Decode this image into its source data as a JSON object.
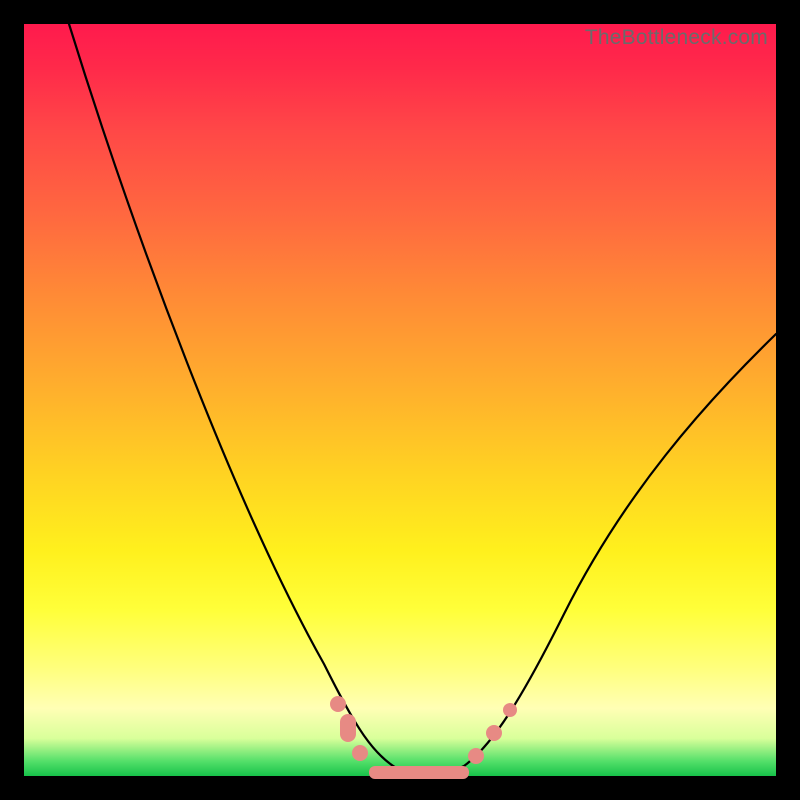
{
  "watermark": "TheBottleneck.com",
  "colors": {
    "background_frame": "#000000",
    "gradient_top": "#ff1a4d",
    "gradient_mid": "#ffd322",
    "gradient_bottom": "#17c24a",
    "curve": "#000000",
    "markers": "#e78a84"
  },
  "chart_data": {
    "type": "line",
    "title": "",
    "xlabel": "",
    "ylabel": "",
    "xlim": [
      0,
      100
    ],
    "ylim": [
      0,
      100
    ],
    "series": [
      {
        "name": "bottleneck-curve",
        "x": [
          6,
          10,
          15,
          20,
          25,
          30,
          35,
          40,
          43,
          46,
          49,
          52,
          55,
          58,
          62,
          68,
          75,
          82,
          90,
          100
        ],
        "y": [
          100,
          91,
          80,
          69,
          58,
          47,
          36,
          24,
          14,
          6,
          1,
          0,
          0,
          1,
          5,
          13,
          24,
          35,
          46,
          59
        ]
      }
    ],
    "annotations": {
      "marker_points_pct": [
        {
          "x": 42,
          "y": 9
        },
        {
          "x": 44,
          "y": 5
        },
        {
          "x": 49,
          "y": 0.5
        },
        {
          "x": 53,
          "y": 0
        },
        {
          "x": 57,
          "y": 0.5
        },
        {
          "x": 60,
          "y": 3
        },
        {
          "x": 63,
          "y": 7
        }
      ],
      "marker_bar_pct": {
        "x_start": 46,
        "x_end": 58,
        "y": 0
      }
    }
  }
}
